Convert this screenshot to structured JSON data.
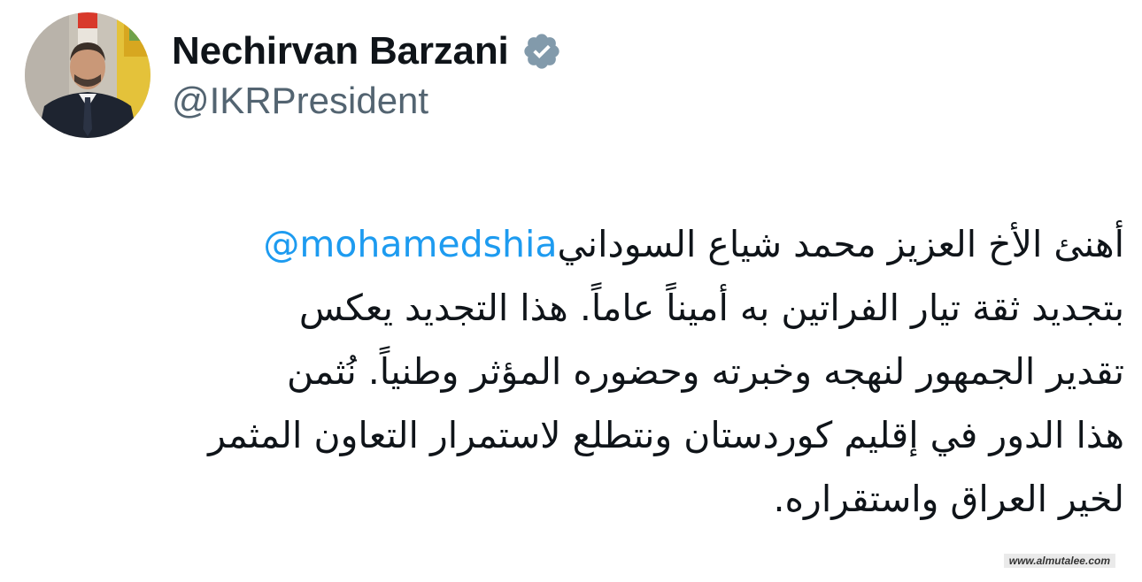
{
  "author": {
    "display_name": "Nechirvan Barzani",
    "handle": "@IKRPresident",
    "verified_icon": "verified-badge-icon",
    "verified_color": "#829aab"
  },
  "tweet": {
    "line1_text": "أهنئ الأخ العزيز محمد شياع السوداني",
    "line1_mention": "@mohamedshia",
    "line2": "بتجديد ثقة تيار الفراتين به أميناً عاماً. هذا التجديد يعكس",
    "line3": "تقدير الجمهور لنهجه وخبرته وحضوره المؤثر وطنياً. نُثمن",
    "line4": "هذا الدور في إقليم كوردستان ونتطلع لاستمرار التعاون المثمر",
    "line5": "لخير العراق واستقراره."
  },
  "colors": {
    "text": "#0f1419",
    "handle": "#536471",
    "mention": "#1d9bf0"
  },
  "watermark": "www.almutalee.com"
}
